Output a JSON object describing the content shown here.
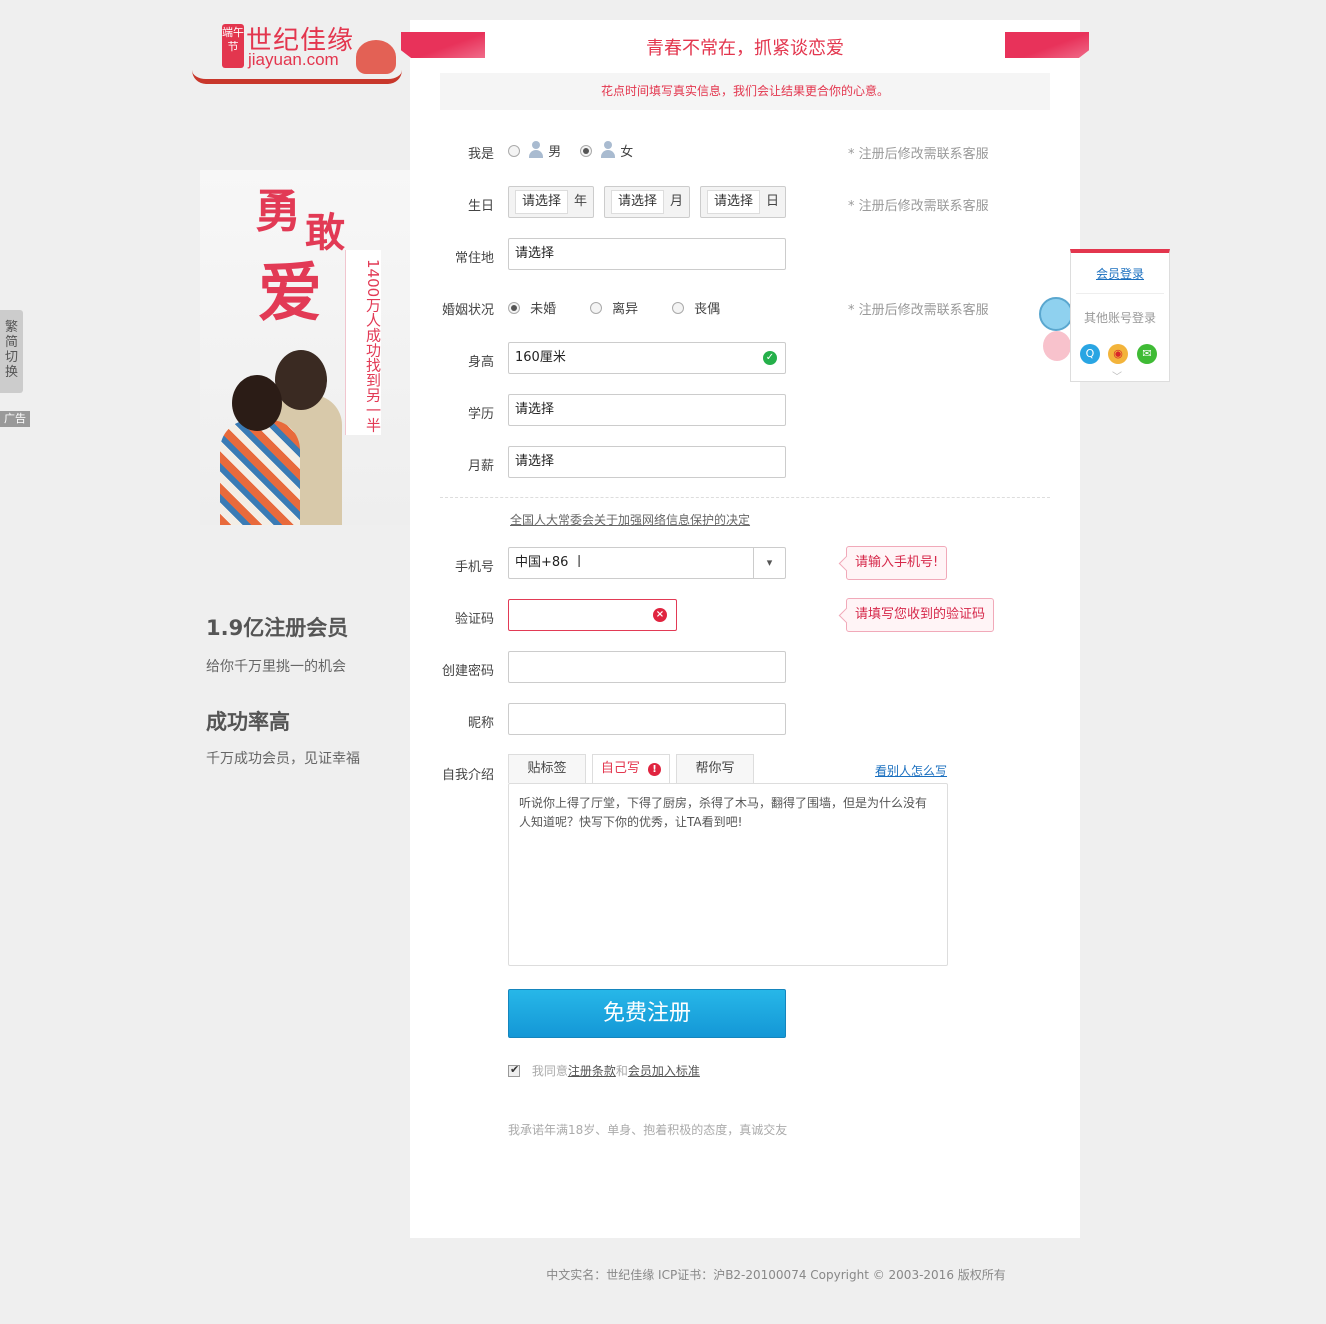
{
  "logo": {
    "badge": "端午节",
    "cn": "世纪佳缘",
    "en": "jiayuan.com"
  },
  "ad": {
    "word1": "勇",
    "word2": "敢",
    "word3": "爱",
    "vertical_text": "1400万人成功找到另一半"
  },
  "side_tab": {
    "label": "繁简切换",
    "ad_label": "广告"
  },
  "stats": [
    {
      "title": "1.9亿注册会员",
      "sub": "给你千万里挑一的机会"
    },
    {
      "title": "成功率高",
      "sub": "千万成功会员，见证幸福"
    }
  ],
  "header": {
    "title": "青春不常在，抓紧谈恋爱",
    "notice": "花点时间填写真实信息，我们会让结果更合你的心意。"
  },
  "form": {
    "gender": {
      "label": "我是",
      "male": "男",
      "female": "女",
      "selected": "female",
      "hint": "* 注册后修改需联系客服"
    },
    "birthday": {
      "label": "生日",
      "year": "请选择",
      "year_unit": "年",
      "month": "请选择",
      "month_unit": "月",
      "day": "请选择",
      "day_unit": "日",
      "hint": "* 注册后修改需联系客服"
    },
    "residence": {
      "label": "常住地",
      "value": "请选择"
    },
    "marital": {
      "label": "婚姻状况",
      "options": [
        "未婚",
        "离异",
        "丧偶"
      ],
      "selected": "未婚",
      "hint": "* 注册后修改需联系客服"
    },
    "height": {
      "label": "身高",
      "value": "160厘米"
    },
    "education": {
      "label": "学历",
      "value": "请选择"
    },
    "salary": {
      "label": "月薪",
      "value": "请选择"
    },
    "privacy_link": "全国人大常委会关于加强网络信息保护的决定",
    "phone": {
      "label": "手机号",
      "value": "中国+86 丨",
      "tip": "请输入手机号!"
    },
    "code": {
      "label": "验证码",
      "value": "",
      "tip": "请填写您收到的验证码"
    },
    "password": {
      "label": "创建密码",
      "value": ""
    },
    "nickname": {
      "label": "昵称",
      "value": ""
    },
    "intro": {
      "label": "自我介绍",
      "tabs": [
        "贴标签",
        "自己写",
        "帮你写"
      ],
      "active_tab": "自己写",
      "see_others": "看别人怎么写",
      "placeholder": "听说你上得了厅堂，下得了厨房，杀得了木马，翻得了围墙，但是为什么没有人知道呢？快写下你的优秀，让TA看到吧!"
    },
    "submit": "免费注册",
    "agree": {
      "prefix": "我同意",
      "terms": "注册条款",
      "and": "和",
      "standard": "会员加入标准",
      "checked": true
    },
    "promise": "我承诺年满18岁、单身、抱着积极的态度，真诚交友"
  },
  "login_widget": {
    "member_login": "会员登录",
    "other_login": "其他账号登录",
    "icons": [
      "qq-icon",
      "weibo-icon",
      "wechat-icon"
    ]
  },
  "footer": "中文实名：世纪佳缘 ICP证书：沪B2-20100074 Copyright © 2003-2016 版权所有",
  "colors": {
    "accent": "#e3364e",
    "button": "#1a9fdc",
    "success": "#25b04a"
  }
}
